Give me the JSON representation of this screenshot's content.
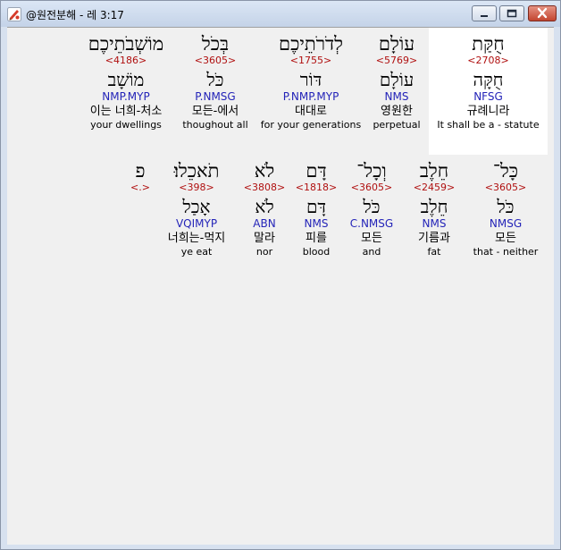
{
  "window": {
    "title": "@원전분해 - 레 3:17"
  },
  "rows": [
    {
      "words": [
        {
          "hebrew": "חֻקַּת",
          "strong": "<2708>",
          "lemma": "חֻקָּה",
          "morph": "NFSG",
          "korean": "규례니라",
          "english": "It shall be a - statute"
        },
        {
          "hebrew": "עוֹלָם",
          "strong": "<5769>",
          "lemma": "עוֹלָם",
          "morph": "NMS",
          "korean": "영원한",
          "english": "perpetual"
        },
        {
          "hebrew": "לְדֹרֹתֵיכֶם",
          "strong": "<1755>",
          "lemma": "דּוֹר",
          "morph": "P.NMP.MYP",
          "korean": "대대로",
          "english": "for your generations"
        },
        {
          "hebrew": "בְּכֹל",
          "strong": "<3605>",
          "lemma": "כֹּל",
          "morph": "P.NMSG",
          "korean": "모든-에서",
          "english": "thoughout all"
        },
        {
          "hebrew": "מוֹשְׁבֹתֵיכֶם",
          "strong": "<4186>",
          "lemma": "מוֹשָׁב",
          "morph": "NMP.MYP",
          "korean": "이는 너희-처소",
          "english": "your dwellings"
        }
      ]
    },
    {
      "words": [
        {
          "hebrew": "כָּל־",
          "strong": "<3605>",
          "lemma": "כֹּל",
          "morph": "NMSG",
          "korean": "모든",
          "english": "that - neither"
        },
        {
          "hebrew": "חֵלֶב",
          "strong": "<2459>",
          "lemma": "חֵלֶב",
          "morph": "NMS",
          "korean": "기름과",
          "english": "fat"
        },
        {
          "hebrew": "וְכָל־",
          "strong": "<3605>",
          "lemma": "כֹּל",
          "morph": "C.NMSG",
          "korean": "모든",
          "english": "and"
        },
        {
          "hebrew": "דָּם",
          "strong": "<1818>",
          "lemma": "דָּם",
          "morph": "NMS",
          "korean": "피를",
          "english": "blood"
        },
        {
          "hebrew": "לֹא",
          "strong": "<3808>",
          "lemma": "לֹא",
          "morph": "ABN",
          "korean": "말라",
          "english": "nor"
        },
        {
          "hebrew": "תֹאכֵלוּ׃",
          "strong": "<398>",
          "lemma": "אָכַל",
          "morph": "VQIMYP",
          "korean": "너희는-먹지",
          "english": "ye eat"
        },
        {
          "hebrew": "פ",
          "strong": "<.>",
          "lemma": "",
          "morph": "",
          "korean": "",
          "english": ""
        }
      ]
    }
  ]
}
